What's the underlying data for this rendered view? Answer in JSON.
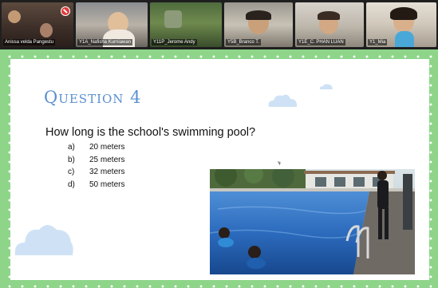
{
  "participants": [
    {
      "name": "Anissa velda Pangestu",
      "muted": true
    },
    {
      "name": "Y1A_Nafisha Kurniawan",
      "muted": false
    },
    {
      "name": "Y11P_Jerome Andy",
      "muted": false
    },
    {
      "name": "Y5B_Branco T.",
      "muted": false
    },
    {
      "name": "Y1E_C. PHAN LUAN",
      "muted": false
    },
    {
      "name": "Y1_Mia",
      "muted": false
    }
  ],
  "slide": {
    "title": "Question 4",
    "question": "How long is the school's swimming pool?",
    "options": [
      {
        "letter": "a)",
        "text": "20 meters"
      },
      {
        "letter": "b)",
        "text": "25 meters"
      },
      {
        "letter": "c)",
        "text": "32 meters"
      },
      {
        "letter": "d)",
        "text": "50 meters"
      }
    ]
  },
  "colors": {
    "border_green": "#8ed58a",
    "title_blue": "#5a8fd0",
    "cloud_blue": "#cfe2f5",
    "mic_muted": "#e03a3a"
  },
  "icons": [
    "mic-muted-icon",
    "cloud-icon",
    "cursor-icon"
  ]
}
